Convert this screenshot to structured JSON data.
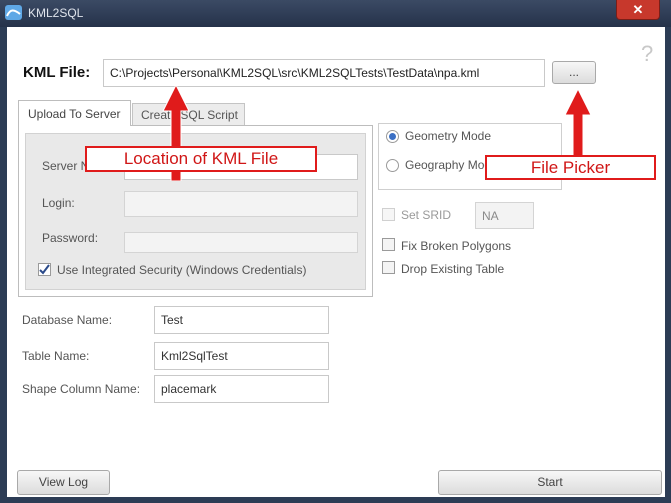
{
  "window": {
    "title": "KML2SQL",
    "close_glyph": "✕",
    "help_glyph": "?"
  },
  "kml": {
    "label": "KML File:",
    "path": "C:\\Projects\\Personal\\KML2SQL\\src\\KML2SQLTests\\TestData\\npa.kml",
    "browse_label": "..."
  },
  "tabs": [
    {
      "label": "Upload To Server"
    },
    {
      "label": "Create SQL Script"
    }
  ],
  "server": {
    "server_label": "Server Name:",
    "login_label": "Login:",
    "password_label": "Password:",
    "integrated_label": "Use Integrated Security (Windows Credentials)"
  },
  "mode": {
    "geometry_label": "Geometry Mode",
    "geography_label": "Geography Mode"
  },
  "options": {
    "srid_label": "Set SRID",
    "srid_value": "NA",
    "fix_label": "Fix Broken Polygons",
    "drop_label": "Drop Existing Table"
  },
  "db": {
    "dbname_label": "Database Name:",
    "dbname_value": "Test",
    "table_label": "Table Name:",
    "table_value": "Kml2SqlTest",
    "shape_label": "Shape Column Name:",
    "shape_value": "placemark"
  },
  "footer": {
    "view_log": "View Log",
    "start": "Start"
  },
  "annotations": {
    "location": "Location of KML File",
    "picker": "File Picker"
  },
  "colors": {
    "annotation_red": "#e01b1b"
  }
}
